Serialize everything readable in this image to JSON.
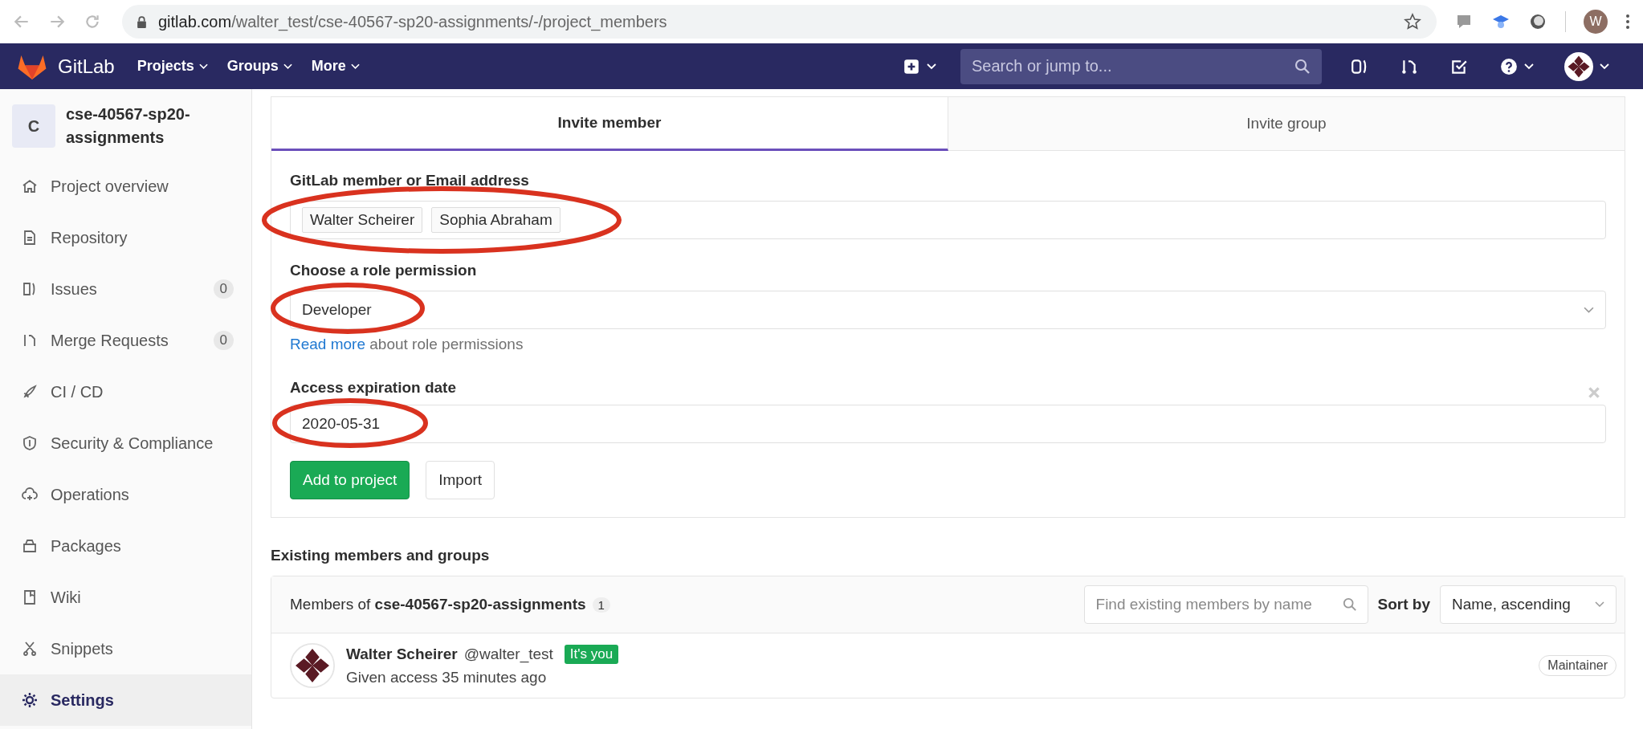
{
  "browser": {
    "url_host": "gitlab.com",
    "url_path": "/walter_test/cse-40567-sp20-assignments/-/project_members",
    "profile_initial": "W"
  },
  "navbar": {
    "logo_text": "GitLab",
    "menus": [
      "Projects",
      "Groups",
      "More"
    ],
    "search_placeholder": "Search or jump to..."
  },
  "sidebar": {
    "project_initial": "C",
    "project_name": "cse-40567-sp20-assignments",
    "items": [
      {
        "label": "Project overview",
        "selected": false
      },
      {
        "label": "Repository",
        "selected": false
      },
      {
        "label": "Issues",
        "badge": "0",
        "selected": false
      },
      {
        "label": "Merge Requests",
        "badge": "0",
        "selected": false
      },
      {
        "label": "CI / CD",
        "selected": false
      },
      {
        "label": "Security & Compliance",
        "selected": false
      },
      {
        "label": "Operations",
        "selected": false
      },
      {
        "label": "Packages",
        "selected": false
      },
      {
        "label": "Wiki",
        "selected": false
      },
      {
        "label": "Snippets",
        "selected": false
      },
      {
        "label": "Settings",
        "selected": true
      }
    ]
  },
  "tabs": [
    {
      "label": "Invite member",
      "selected": true
    },
    {
      "label": "Invite group",
      "selected": false
    }
  ],
  "form": {
    "member_label": "GitLab member or Email address",
    "members": [
      "Walter Scheirer",
      "Sophia Abraham"
    ],
    "members_circled": true,
    "role_label": "Choose a role permission",
    "role_value": "Developer",
    "role_circled": true,
    "read_more_link": "Read more",
    "read_more_text": "about role permissions",
    "expiration_label": "Access expiration date",
    "expiration_value": "2020-05-31",
    "expiration_circled": true,
    "buttons": [
      {
        "label": "Add to project",
        "kind": "primary"
      },
      {
        "label": "Import",
        "kind": "default"
      }
    ]
  },
  "existing": {
    "title": "Existing members and groups",
    "members_prefix": "Members of",
    "project": "cse-40567-sp20-assignments",
    "count": "1",
    "search_placeholder": "Find existing members by name",
    "sort_label": "Sort by",
    "sort_value": "Name, ascending",
    "members": [
      {
        "name": "Walter Scheirer",
        "username": "@walter_test",
        "badge": "It's you",
        "access": "Given access 35 minutes ago",
        "role": "Maintainer"
      }
    ]
  }
}
